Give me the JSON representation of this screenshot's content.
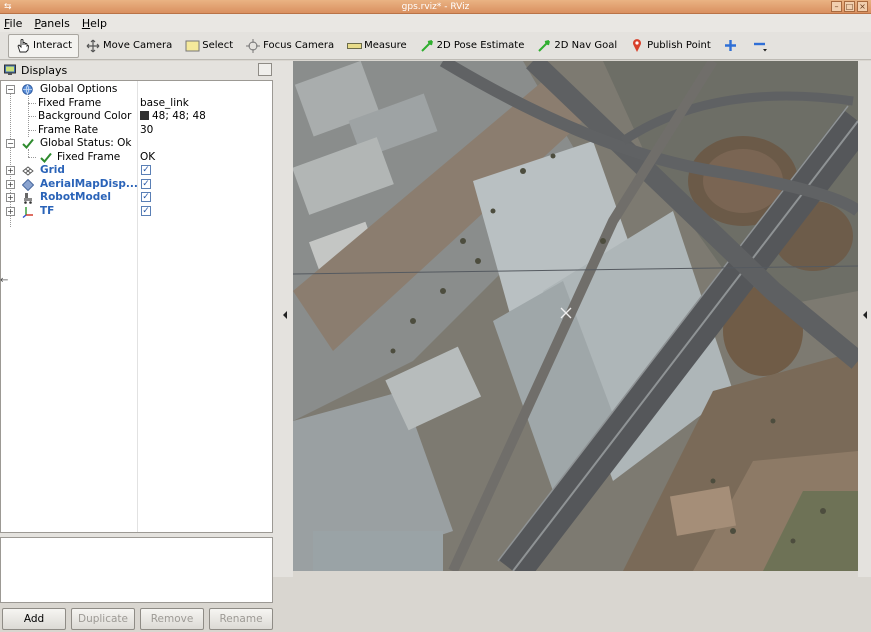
{
  "window": {
    "title": "gps.rviz* - RViz"
  },
  "menu": [
    {
      "label": "File",
      "mnemonic": "F",
      "rest": "ile"
    },
    {
      "label": "Panels",
      "mnemonic": "P",
      "rest": "anels"
    },
    {
      "label": "Help",
      "mnemonic": "H",
      "rest": "elp"
    }
  ],
  "toolbar": {
    "interact": "Interact",
    "move_camera": "Move Camera",
    "select": "Select",
    "focus_camera": "Focus Camera",
    "measure": "Measure",
    "pose_estimate": "2D Pose Estimate",
    "nav_goal": "2D Nav Goal",
    "publish_point": "Publish Point",
    "active_tool": "Interact"
  },
  "displays": {
    "title": "Displays",
    "global_options": {
      "label": "Global Options",
      "fixed_frame_label": "Fixed Frame",
      "fixed_frame_value": "base_link",
      "background_color_label": "Background Color",
      "background_color_value": "48; 48; 48",
      "background_color_hex": "#303030",
      "frame_rate_label": "Frame Rate",
      "frame_rate_value": "30"
    },
    "global_status": {
      "label": "Global Status: Ok",
      "fixed_frame_label": "Fixed Frame",
      "fixed_frame_value": "OK"
    },
    "items": [
      {
        "label": "Grid",
        "enabled": true,
        "icon": "grid-icon"
      },
      {
        "label": "AerialMapDisp...",
        "enabled": true,
        "icon": "aerial-map-icon"
      },
      {
        "label": "RobotModel",
        "enabled": true,
        "icon": "robot-model-icon"
      },
      {
        "label": "TF",
        "enabled": true,
        "icon": "tf-axes-icon"
      }
    ]
  },
  "buttons": {
    "add": "Add",
    "duplicate": "Duplicate",
    "remove": "Remove",
    "rename": "Rename"
  },
  "colors": {
    "titlebar": "#de9a68",
    "accent_blue": "#2a63b8",
    "status_ok": "#2e8b2e"
  }
}
